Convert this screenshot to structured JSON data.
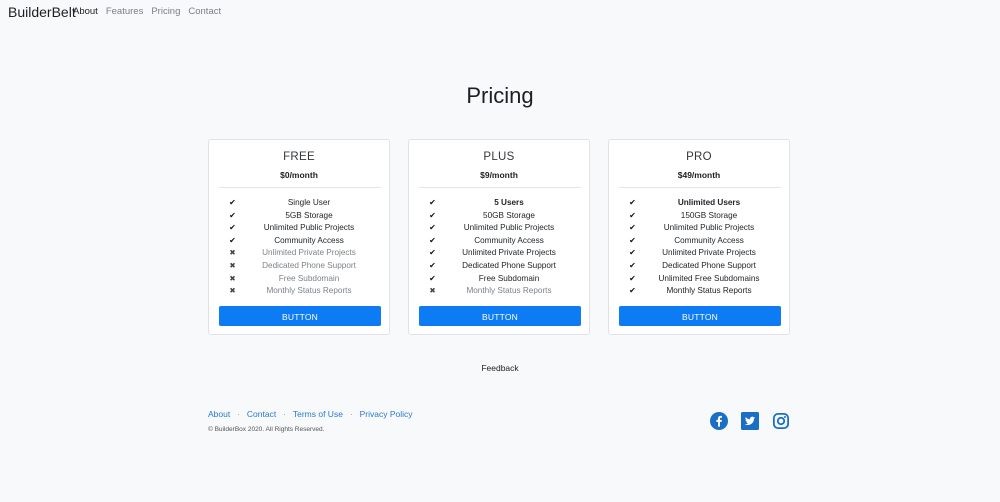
{
  "navbar": {
    "brand": "BuilderBelt",
    "links": [
      "About",
      "Features",
      "Pricing",
      "Contact"
    ]
  },
  "page": {
    "title": "Pricing"
  },
  "plans": [
    {
      "name": "FREE",
      "price": "$0/month",
      "features": [
        {
          "label": "Single User",
          "included": true
        },
        {
          "label": "5GB Storage",
          "included": true
        },
        {
          "label": "Unlimited Public Projects",
          "included": true
        },
        {
          "label": "Community Access",
          "included": true
        },
        {
          "label": "Unlimited Private Projects",
          "included": false
        },
        {
          "label": "Dedicated Phone Support",
          "included": false
        },
        {
          "label": "Free Subdomain",
          "included": false
        },
        {
          "label": "Monthly Status Reports",
          "included": false
        }
      ],
      "button": "BUTTON"
    },
    {
      "name": "PLUS",
      "price": "$9/month",
      "features": [
        {
          "label": "5 Users",
          "included": true
        },
        {
          "label": "50GB Storage",
          "included": true
        },
        {
          "label": "Unlimited Public Projects",
          "included": true
        },
        {
          "label": "Community Access",
          "included": true
        },
        {
          "label": "Unlimited Private Projects",
          "included": true
        },
        {
          "label": "Dedicated Phone Support",
          "included": true
        },
        {
          "label": "Free Subdomain",
          "included": true
        },
        {
          "label": "Monthly Status Reports",
          "included": false
        }
      ],
      "button": "BUTTON"
    },
    {
      "name": "PRO",
      "price": "$49/month",
      "features": [
        {
          "label": "Unlimited Users",
          "included": true
        },
        {
          "label": "150GB Storage",
          "included": true
        },
        {
          "label": "Unlimited Public Projects",
          "included": true
        },
        {
          "label": "Community Access",
          "included": true
        },
        {
          "label": "Unlimited Private Projects",
          "included": true
        },
        {
          "label": "Dedicated Phone Support",
          "included": true
        },
        {
          "label": "Unlimited Free Subdomains",
          "included": true
        },
        {
          "label": "Monthly Status Reports",
          "included": true
        }
      ],
      "button": "BUTTON"
    }
  ],
  "feedback": "Feedback",
  "footer": {
    "links": [
      "About",
      "Contact",
      "Terms of Use",
      "Privacy Policy"
    ],
    "separator": "·",
    "copyright": "© BuilderBox 2020. All Rights Reserved.",
    "social": [
      "facebook-icon",
      "twitter-icon",
      "instagram-icon"
    ]
  },
  "colors": {
    "accent": "#0d7bf4",
    "link": "#2a79c9",
    "social": "#1a6fc4",
    "background": "#f8f9fb"
  }
}
